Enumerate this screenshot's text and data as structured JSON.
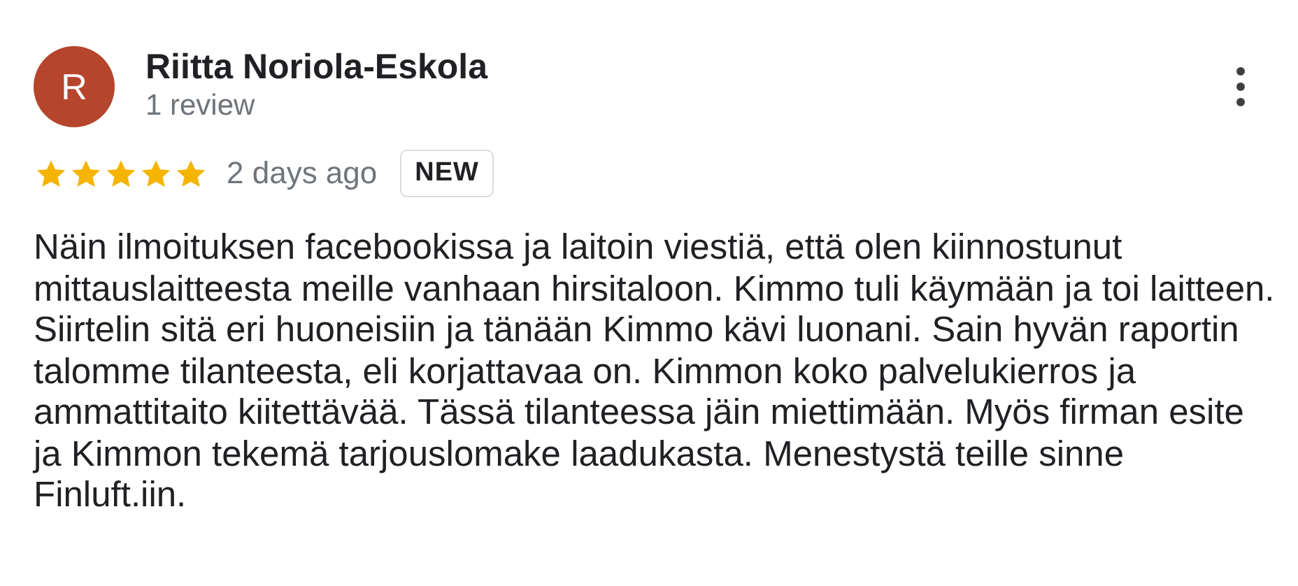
{
  "reviewer": {
    "initial": "R",
    "name": "Riitta Noriola-Eskola",
    "review_count": "1 review",
    "color": "#b5452b"
  },
  "rating": {
    "stars": 5
  },
  "date": "2 days ago",
  "badge": "NEW",
  "text": "Näin ilmoituksen facebookissa ja laitoin viestiä, että olen kiinnostunut mittauslaitteesta meille vanhaan hirsitaloon. Kimmo tuli käymään ja toi laitteen. Siirtelin sitä eri huoneisiin ja tänään Kimmo kävi luonani. Sain hyvän raportin talomme tilanteesta, eli korjattavaa on. Kimmon koko palvelukierros ja ammattitaito kiitettävää. Tässä tilanteessa jäin miettimään. Myös firman esite ja Kimmon tekemä tarjouslomake laadukasta. Menestystä teille sinne Finluft.iin."
}
